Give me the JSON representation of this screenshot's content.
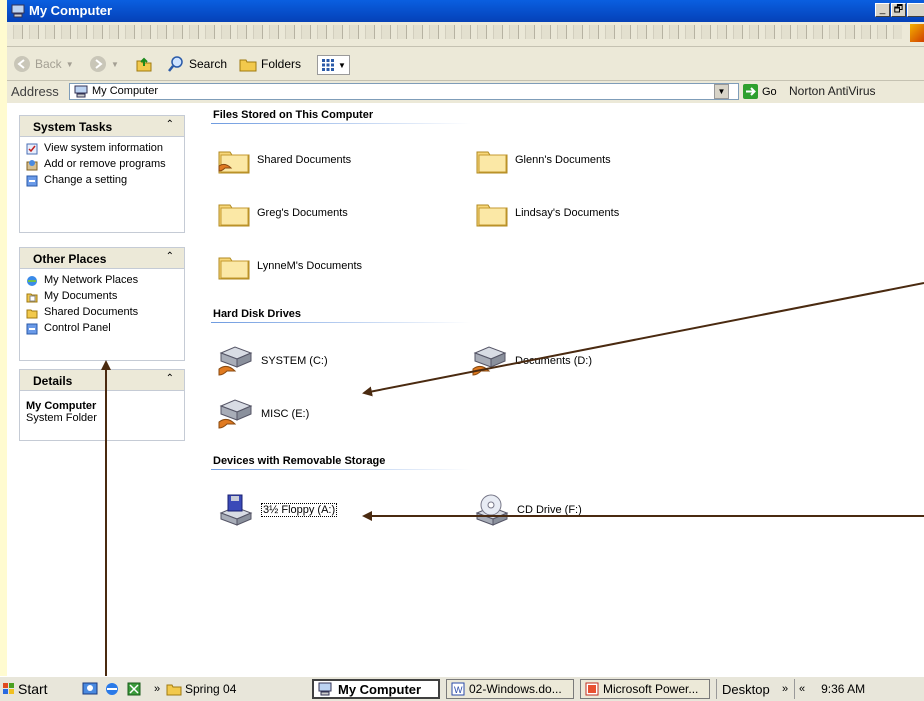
{
  "window": {
    "title": "My Computer",
    "controls": {
      "minimize": "_",
      "maximize": "🗗"
    }
  },
  "toolbar": {
    "back": "Back",
    "search": "Search",
    "folders": "Folders"
  },
  "addressbar": {
    "label": "Address",
    "value": "My Computer",
    "go": "Go",
    "norton": "Norton AntiVirus"
  },
  "sidebar": {
    "system_tasks": {
      "title": "System Tasks",
      "items": [
        {
          "label": "View system information",
          "icon": "system-info-icon"
        },
        {
          "label": "Add or remove programs",
          "icon": "add-remove-icon"
        },
        {
          "label": "Change a setting",
          "icon": "control-panel-icon"
        }
      ]
    },
    "other_places": {
      "title": "Other Places",
      "items": [
        {
          "label": "My Network Places",
          "icon": "network-places-icon"
        },
        {
          "label": "My Documents",
          "icon": "my-documents-icon"
        },
        {
          "label": "Shared Documents",
          "icon": "folder-icon"
        },
        {
          "label": "Control Panel",
          "icon": "control-panel-icon"
        }
      ]
    },
    "details": {
      "title": "Details",
      "name": "My Computer",
      "type": "System Folder"
    }
  },
  "content": {
    "files_group": {
      "title": "Files Stored on This Computer",
      "items": [
        "Shared Documents",
        "Glenn's Documents",
        "Greg's Documents",
        "Lindsay's Documents",
        "LynneM's Documents"
      ]
    },
    "hdd_group": {
      "title": "Hard Disk Drives",
      "items": [
        "SYSTEM (C:)",
        "Documents (D:)",
        "MISC (E:)"
      ]
    },
    "removable_group": {
      "title": "Devices with Removable Storage",
      "items": [
        "3½ Floppy (A:)",
        "CD Drive (F:)"
      ]
    }
  },
  "taskbar": {
    "start": "Start",
    "chevron": "»",
    "spring": "Spring 04",
    "my_computer": "My Computer",
    "doc": "02-Windows.do...",
    "power": "Microsoft Power...",
    "desktop": "Desktop",
    "tray_chevron": "«",
    "clock": "9:36 AM"
  },
  "colors": {
    "titlebar": "#0a5fe0",
    "annotation_arrow": "#4a2a10",
    "page_background": "#fffbd0"
  }
}
